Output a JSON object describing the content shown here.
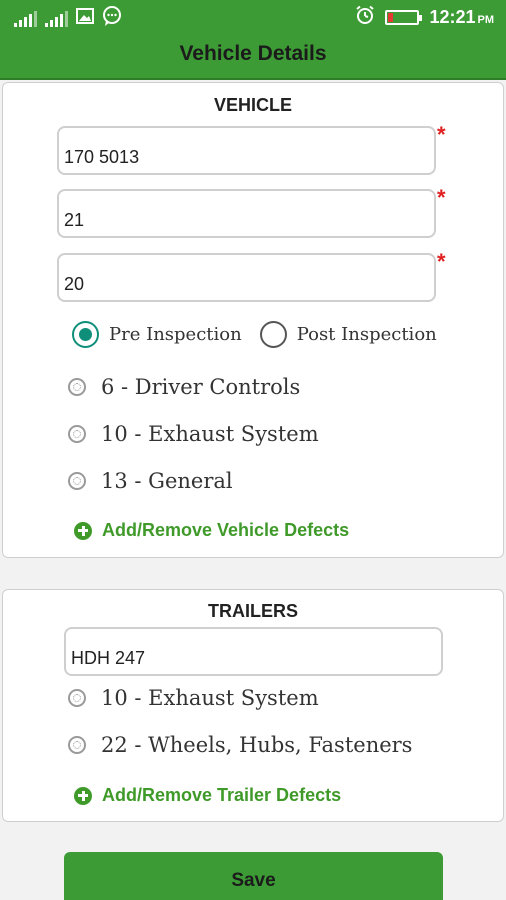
{
  "status_bar": {
    "time": "12:21",
    "ampm": "PM",
    "icons": [
      "signal-icon",
      "signal-icon",
      "image-icon",
      "chat-icon",
      "alarm-icon",
      "battery-icon"
    ]
  },
  "app_bar": {
    "title": "Vehicle Details"
  },
  "vehicle": {
    "title": "VEHICLE",
    "fields": [
      {
        "value": "170 5013",
        "required_mark": "*"
      },
      {
        "value": "21",
        "required_mark": "*"
      },
      {
        "value": "20",
        "required_mark": "*"
      }
    ],
    "inspection": {
      "pre_label": "Pre Inspection",
      "post_label": "Post Inspection",
      "selected": "pre"
    },
    "defects": [
      "6 - Driver Controls",
      "10 - Exhaust System",
      "13 - General"
    ],
    "add_label": "Add/Remove Vehicle Defects"
  },
  "trailers": {
    "title": "TRAILERS",
    "field_value": "HDH 247",
    "defects": [
      "10 - Exhaust System",
      "22 - Wheels, Hubs, Fasteners"
    ],
    "add_label": "Add/Remove Trailer Defects"
  },
  "save_label": "Save",
  "colors": {
    "brand_green": "#3c9b35",
    "radio_teal": "#0f8f7a",
    "required_red": "#e02020"
  }
}
